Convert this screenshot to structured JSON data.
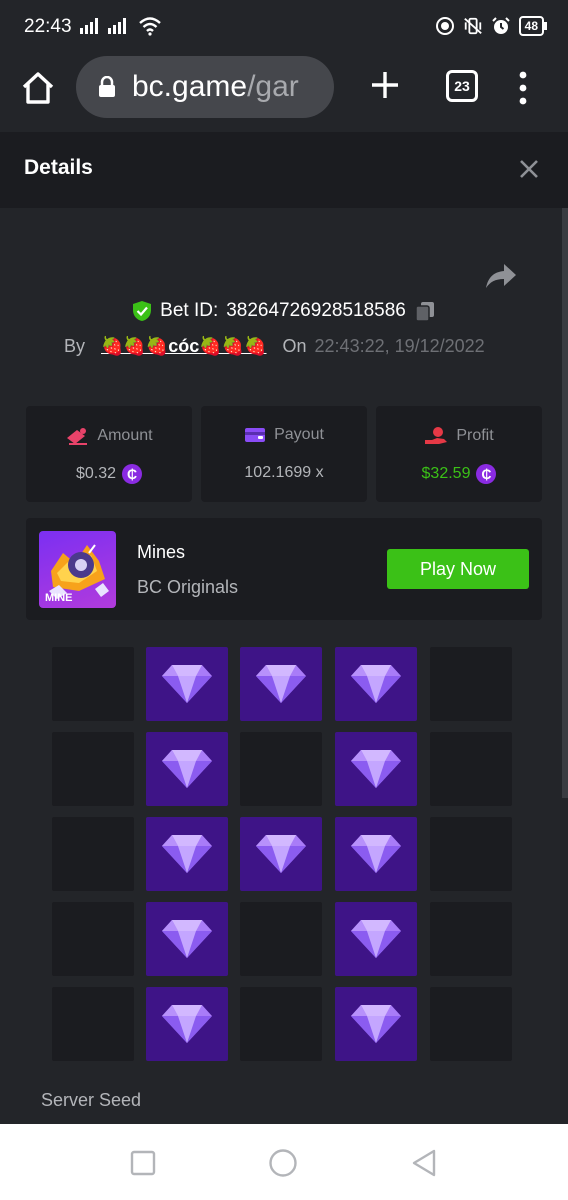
{
  "status_bar": {
    "time": "22:43",
    "battery": "48"
  },
  "browser": {
    "url_host": "bc.game",
    "url_path": "/gar",
    "tab_count": "23"
  },
  "details": {
    "title": "Details",
    "bet_id_label": "Bet ID:",
    "bet_id": "38264726928518586",
    "by_label": "By",
    "username": "🍓🍓🍓cóc🍓🍓🍓",
    "on_label": "On",
    "date": "22:43:22, 19/12/2022"
  },
  "stats": {
    "amount_label": "Amount",
    "amount_value": "$0.32",
    "payout_label": "Payout",
    "payout_value": "102.1699 x",
    "profit_label": "Profit",
    "profit_value": "$32.59",
    "coin_symbol": "₵"
  },
  "game": {
    "name": "Mines",
    "provider": "BC Originals",
    "thumb_tag": "MINE",
    "play_label": "Play Now"
  },
  "board": {
    "cells": [
      [
        0,
        1,
        1,
        1,
        0
      ],
      [
        0,
        1,
        0,
        1,
        0
      ],
      [
        0,
        1,
        1,
        1,
        0
      ],
      [
        0,
        1,
        0,
        1,
        0
      ],
      [
        0,
        1,
        0,
        1,
        0
      ]
    ]
  },
  "server_seed_label": "Server Seed",
  "colors": {
    "gem_tile": "#3e1487",
    "empty_tile": "#1b1c20",
    "play_button": "#3bc117",
    "profit": "#3bc117",
    "amount_icon": "#e8436a",
    "payout_icon": "#8a4cf6",
    "profit_icon": "#e63946"
  }
}
